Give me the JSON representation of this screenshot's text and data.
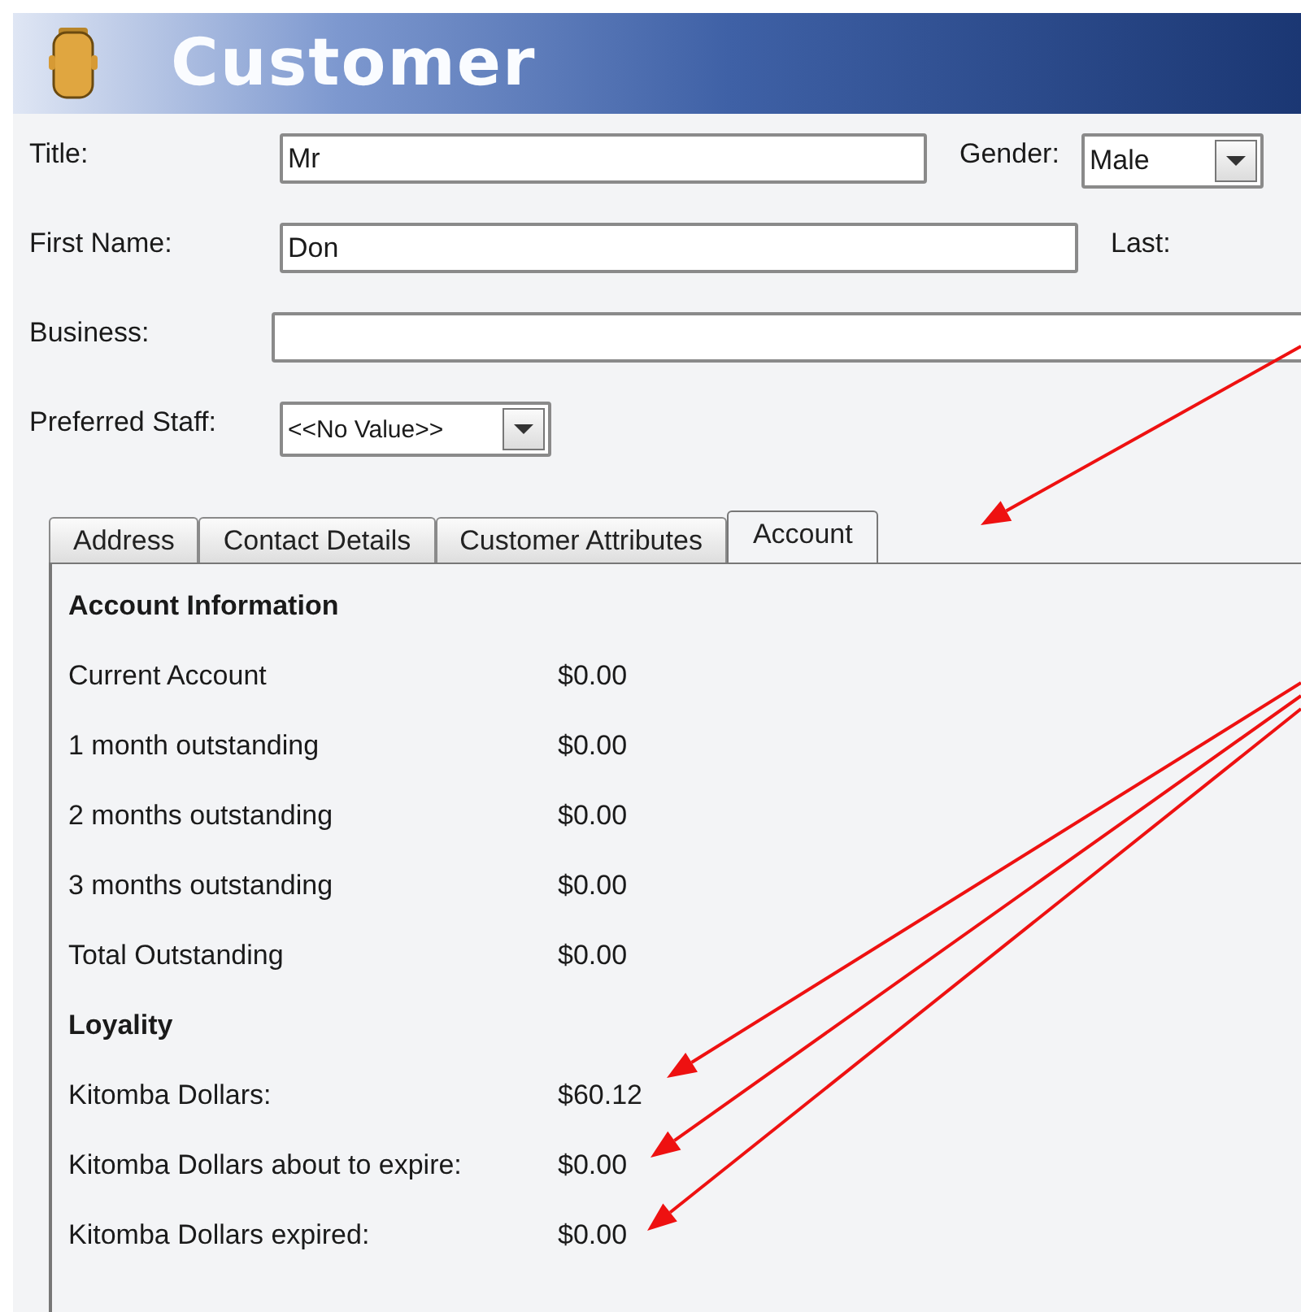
{
  "header": {
    "title": "Customer"
  },
  "form": {
    "title": {
      "label": "Title:",
      "value": "Mr"
    },
    "gender": {
      "label": "Gender:",
      "value": "Male"
    },
    "first_name": {
      "label": "First Name:",
      "value": "Don"
    },
    "last": {
      "label": "Last:"
    },
    "business": {
      "label": "Business:"
    },
    "preferred_staff": {
      "label": "Preferred Staff:",
      "value": "<<No Value>>"
    }
  },
  "tabs": [
    {
      "label": "Address",
      "selected": false
    },
    {
      "label": "Contact Details",
      "selected": false
    },
    {
      "label": "Customer Attributes",
      "selected": false
    },
    {
      "label": "Account",
      "selected": true
    }
  ],
  "sections": [
    {
      "heading": "Account Information",
      "rows": [
        {
          "label": "Current Account",
          "value": "$0.00"
        },
        {
          "label": "1 month outstanding",
          "value": "$0.00"
        },
        {
          "label": "2 months outstanding",
          "value": "$0.00"
        },
        {
          "label": "3 months outstanding",
          "value": "$0.00"
        },
        {
          "label": "Total Outstanding",
          "value": "$0.00"
        }
      ]
    },
    {
      "heading": "Loyality",
      "rows": [
        {
          "label": "Kitomba Dollars:",
          "value": "$60.12"
        },
        {
          "label": "Kitomba Dollars about to expire:",
          "value": "$0.00"
        },
        {
          "label": "Kitomba Dollars expired:",
          "value": "$0.00"
        }
      ]
    }
  ]
}
